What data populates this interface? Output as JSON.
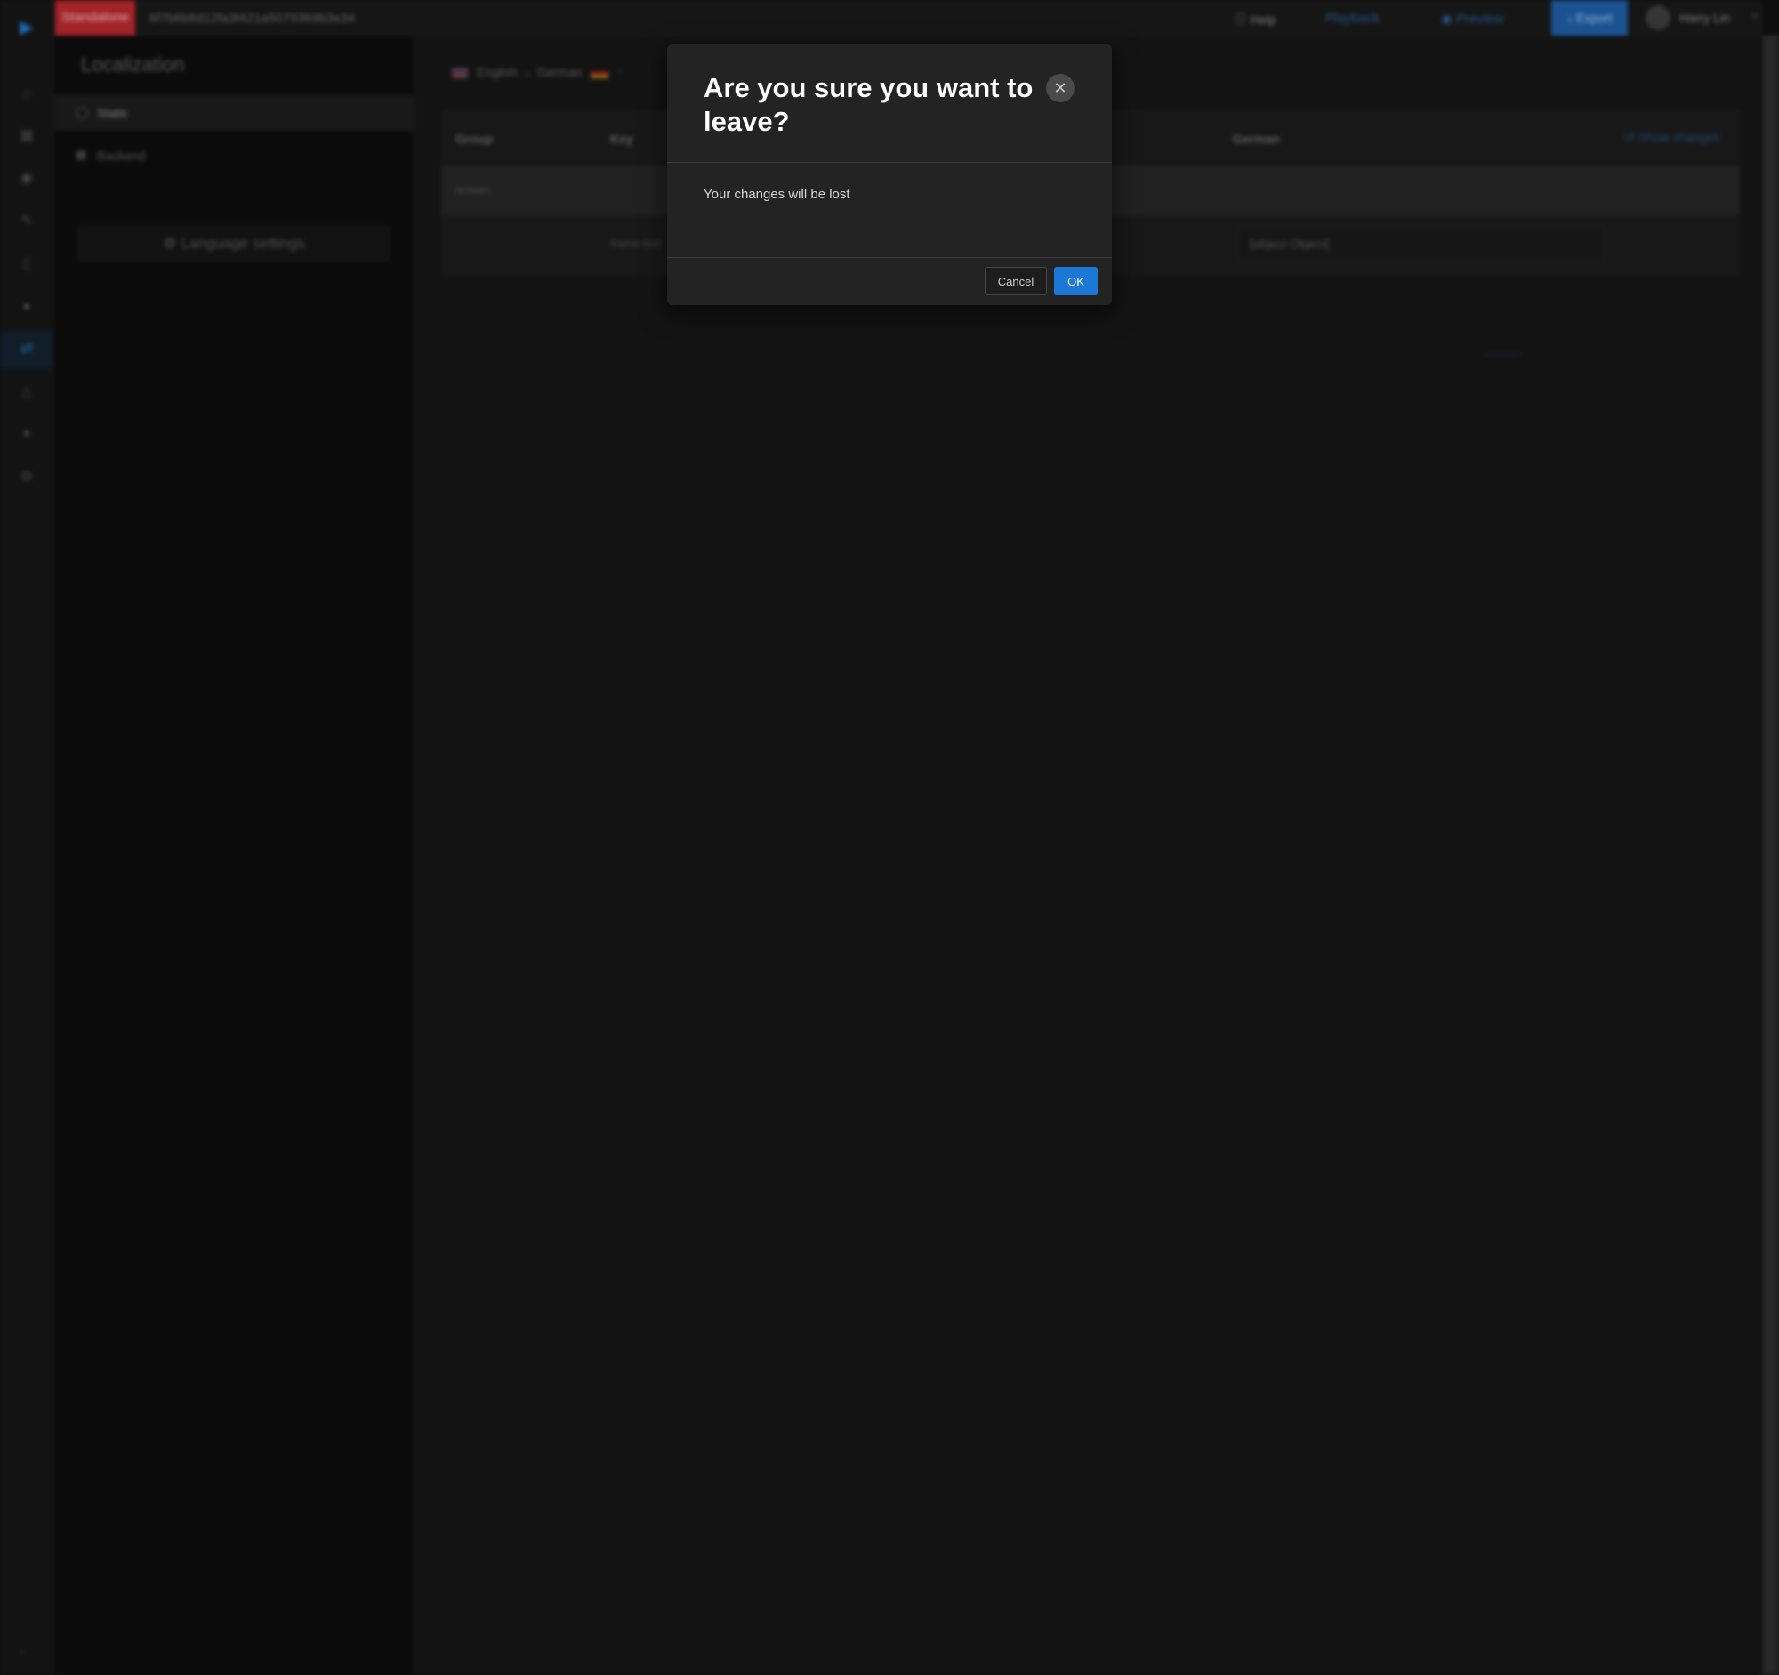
{
  "topbar": {
    "env_badge": "Standalone",
    "project_id": "6f7b6b6d12fa3f421a5079369b3e34",
    "help_label": "Help",
    "playback_label": "Playback",
    "preview_label": "Preview",
    "export_label": "Export",
    "user_name": "Harry Lin"
  },
  "sidebar": {
    "title": "Localization",
    "items": [
      {
        "label": "Static",
        "icon": "globe-icon"
      },
      {
        "label": "Backend",
        "icon": "database-icon"
      }
    ],
    "language_settings_label": "Language settings"
  },
  "main": {
    "language_pair": {
      "source": "English",
      "arrow": "→",
      "target": "German"
    },
    "table": {
      "headers": {
        "group": "Group",
        "key": "Key",
        "german": "German"
      },
      "show_changes_label": "Show changes",
      "group_row": "screen",
      "item_row": {
        "key": "frame text",
        "german_value": "[object Object]"
      }
    }
  },
  "modal": {
    "title": "Are you sure you want to leave?",
    "message": "Your changes will be lost",
    "cancel_label": "Cancel",
    "ok_label": "OK"
  },
  "colors": {
    "accent": "#1b78d6",
    "danger": "#b0262c",
    "modal_bg": "#232323",
    "page_bg": "#151515"
  }
}
